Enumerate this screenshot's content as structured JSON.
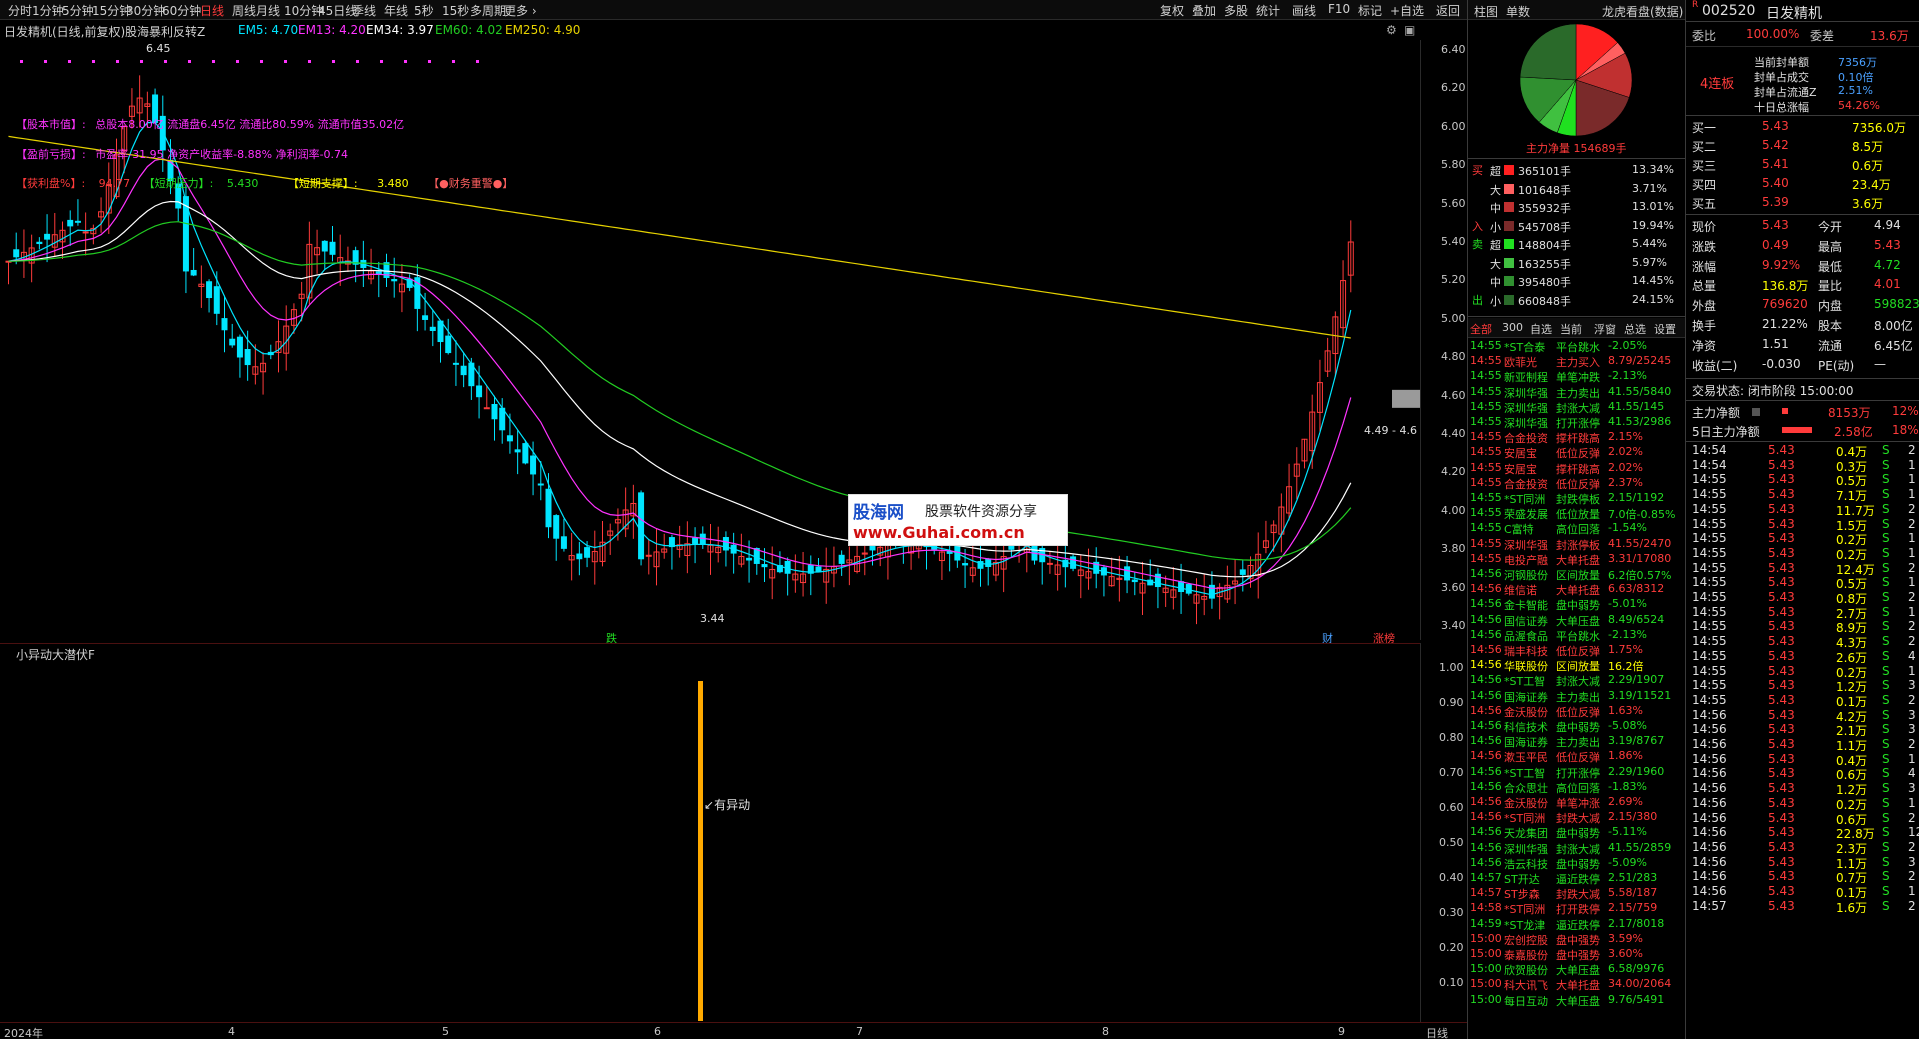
{
  "toolbar": {
    "left": [
      "分时",
      "1分钟",
      "5分钟",
      "15分钟",
      "30分钟",
      "60分钟",
      "日线",
      "周线",
      "月线",
      "10分钟",
      "45日线",
      "季线",
      "年线",
      "5秒",
      "15秒",
      "多周期",
      "更多 ›"
    ],
    "active": "日线",
    "right": [
      "复权",
      "叠加",
      "多股",
      "统计",
      "画线",
      "F10",
      "标记",
      "+自选",
      "返回"
    ]
  },
  "chart_info": {
    "title": "日发精机(日线,前复权)",
    "indicator": "股海暴利反转Z",
    "em5": "EM5: 4.70",
    "em13": "EM13: 4.20",
    "em34": "EM34: 3.97",
    "em60": "EM60: 4.02",
    "em250": "EM250: 4.90"
  },
  "fundamentals": {
    "line1_label": "【股本市值】:",
    "line1_value": "总股本8.00亿  流通盘6.45亿  流通比80.59%  流通市值35.02亿",
    "line2_label": "【盈前亏损】:",
    "line2_value": "市盈率-31.95  净资产收益率-8.88%  净利润率-0.74",
    "line3_label": "【获利盘%】:",
    "line3_value": "94.77",
    "pressure_label": "【短期压力】:",
    "pressure_value": "5.430",
    "support_label": "【短期支撑】:",
    "support_value": "3.480",
    "risk": "【●财务重警●】"
  },
  "price_axis": [
    "6.40",
    "6.20",
    "6.00",
    "5.80",
    "5.60",
    "5.40",
    "5.20",
    "5.00",
    "4.80",
    "4.60",
    "4.40",
    "4.20",
    "4.00",
    "3.80",
    "3.60",
    "3.40"
  ],
  "chart_labels": {
    "high": "6.45",
    "low": "3.44",
    "range": "4.49 - 4.6",
    "tag_down": "跌",
    "tag_fin": "财",
    "tag_limit": "涨榜"
  },
  "sub_chart": {
    "title": "小异动大潜伏F",
    "signal": "有异动",
    "axis": [
      "1.00",
      "0.90",
      "0.80",
      "0.70",
      "0.60",
      "0.50",
      "0.40",
      "0.30",
      "0.20",
      "0.10"
    ]
  },
  "date_axis": {
    "labels": [
      "2024年",
      "4",
      "5",
      "6",
      "7",
      "8",
      "9"
    ],
    "period": "日线"
  },
  "mid_panel": {
    "tabs": [
      "柱图",
      "单数"
    ],
    "dragon": "龙虎看盘(数据)",
    "net_inflow": "主力净量 154689手",
    "buy_label": "买",
    "sell_label": "卖",
    "in_label": "入",
    "out_label": "出",
    "flows": [
      {
        "size": "超",
        "vol": "365101手",
        "pct": "13.34%",
        "color": "#ff2020"
      },
      {
        "size": "大",
        "vol": "101648手",
        "pct": "3.71%",
        "color": "#ff6060"
      },
      {
        "size": "中",
        "vol": "355932手",
        "pct": "13.01%",
        "color": "#c03030"
      },
      {
        "size": "小",
        "vol": "545708手",
        "pct": "19.94%",
        "color": "#7a2a2a"
      },
      {
        "size": "超",
        "vol": "148804手",
        "pct": "5.44%",
        "color": "#20e020"
      },
      {
        "size": "大",
        "vol": "163255手",
        "pct": "5.97%",
        "color": "#40c040"
      },
      {
        "size": "中",
        "vol": "395480手",
        "pct": "14.45%",
        "color": "#309030"
      },
      {
        "size": "小",
        "vol": "660848手",
        "pct": "24.15%",
        "color": "#2a6a2a"
      }
    ],
    "list_tabs": [
      "全部",
      "300",
      "自选",
      "当前",
      "浮窗",
      "总选",
      "设置"
    ],
    "alerts": [
      {
        "t": "14:55",
        "n": "*ST合泰",
        "e": "平台跳水",
        "v": "-2.05%",
        "c": "green"
      },
      {
        "t": "14:55",
        "n": "欧菲光",
        "e": "主力买入",
        "v": "8.79/25245",
        "c": "red"
      },
      {
        "t": "14:55",
        "n": "新亚制程",
        "e": "单笔冲跌",
        "v": "-2.13%",
        "c": "green"
      },
      {
        "t": "14:55",
        "n": "深圳华强",
        "e": "主力卖出",
        "v": "41.55/5840",
        "c": "green"
      },
      {
        "t": "14:55",
        "n": "深圳华强",
        "e": "封涨大减",
        "v": "41.55/145",
        "c": "green"
      },
      {
        "t": "14:55",
        "n": "深圳华强",
        "e": "打开涨停",
        "v": "41.53/2986",
        "c": "green"
      },
      {
        "t": "14:55",
        "n": "合金投资",
        "e": "撑杆跳高",
        "v": "2.15%",
        "c": "red"
      },
      {
        "t": "14:55",
        "n": "安居宝",
        "e": "低位反弹",
        "v": "2.02%",
        "c": "red"
      },
      {
        "t": "14:55",
        "n": "安居宝",
        "e": "撑杆跳高",
        "v": "2.02%",
        "c": "red"
      },
      {
        "t": "14:55",
        "n": "合金投资",
        "e": "低位反弹",
        "v": "2.37%",
        "c": "red"
      },
      {
        "t": "14:55",
        "n": "*ST同洲",
        "e": "封跌停板",
        "v": "2.15/1192",
        "c": "green"
      },
      {
        "t": "14:55",
        "n": "荣盛发展",
        "e": "低位放量",
        "v": "7.0倍-0.85%",
        "c": "green"
      },
      {
        "t": "14:55",
        "n": "C富特",
        "e": "高位回落",
        "v": "-1.54%",
        "c": "green"
      },
      {
        "t": "14:55",
        "n": "深圳华强",
        "e": "封涨停板",
        "v": "41.55/2470",
        "c": "red"
      },
      {
        "t": "14:55",
        "n": "电投产融",
        "e": "大单托盘",
        "v": "3.31/17080",
        "c": "red"
      },
      {
        "t": "14:56",
        "n": "河钢股份",
        "e": "区间放量",
        "v": "6.2倍0.57%",
        "c": "green"
      },
      {
        "t": "14:56",
        "n": "维信诺",
        "e": "大单托盘",
        "v": "6.63/8312",
        "c": "red"
      },
      {
        "t": "14:56",
        "n": "金卡智能",
        "e": "盘中弱势",
        "v": "-5.01%",
        "c": "green"
      },
      {
        "t": "14:56",
        "n": "国信证券",
        "e": "大单压盘",
        "v": "8.49/6524",
        "c": "green"
      },
      {
        "t": "14:56",
        "n": "品渥食品",
        "e": "平台跳水",
        "v": "-2.13%",
        "c": "green"
      },
      {
        "t": "14:56",
        "n": "瑞丰科技",
        "e": "低位反弹",
        "v": "1.75%",
        "c": "red"
      },
      {
        "t": "14:56",
        "n": "华联股份",
        "e": "区间放量",
        "v": "16.2倍",
        "c": "yellow"
      },
      {
        "t": "14:56",
        "n": "*ST工智",
        "e": "封涨大减",
        "v": "2.29/1907",
        "c": "green"
      },
      {
        "t": "14:56",
        "n": "国海证券",
        "e": "主力卖出",
        "v": "3.19/11521",
        "c": "green"
      },
      {
        "t": "14:56",
        "n": "金沃股份",
        "e": "低位反弹",
        "v": "1.63%",
        "c": "red"
      },
      {
        "t": "14:56",
        "n": "科信技术",
        "e": "盘中弱势",
        "v": "-5.08%",
        "c": "green"
      },
      {
        "t": "14:56",
        "n": "国海证券",
        "e": "主力卖出",
        "v": "3.19/8767",
        "c": "green"
      },
      {
        "t": "14:56",
        "n": "漱玉平民",
        "e": "低位反弹",
        "v": "1.86%",
        "c": "red"
      },
      {
        "t": "14:56",
        "n": "*ST工智",
        "e": "打开涨停",
        "v": "2.29/1960",
        "c": "green"
      },
      {
        "t": "14:56",
        "n": "合众思壮",
        "e": "高位回落",
        "v": "-1.83%",
        "c": "green"
      },
      {
        "t": "14:56",
        "n": "金沃股份",
        "e": "单笔冲涨",
        "v": "2.69%",
        "c": "red"
      },
      {
        "t": "14:56",
        "n": "*ST同洲",
        "e": "封跌大减",
        "v": "2.15/380",
        "c": "red"
      },
      {
        "t": "14:56",
        "n": "天龙集团",
        "e": "盘中弱势",
        "v": "-5.11%",
        "c": "green"
      },
      {
        "t": "14:56",
        "n": "深圳华强",
        "e": "封涨大减",
        "v": "41.55/2859",
        "c": "green"
      },
      {
        "t": "14:56",
        "n": "浩云科技",
        "e": "盘中弱势",
        "v": "-5.09%",
        "c": "green"
      },
      {
        "t": "14:57",
        "n": "ST开达",
        "e": "逼近跌停",
        "v": "2.51/283",
        "c": "green"
      },
      {
        "t": "14:57",
        "n": "ST步森",
        "e": "封跌大减",
        "v": "5.58/187",
        "c": "red"
      },
      {
        "t": "14:58",
        "n": "*ST同洲",
        "e": "打开跌停",
        "v": "2.15/759",
        "c": "red"
      },
      {
        "t": "14:59",
        "n": "*ST龙津",
        "e": "逼近跌停",
        "v": "2.17/8018",
        "c": "green"
      },
      {
        "t": "15:00",
        "n": "宏创控股",
        "e": "盘中强势",
        "v": "3.59%",
        "c": "red"
      },
      {
        "t": "15:00",
        "n": "泰嘉股份",
        "e": "盘中强势",
        "v": "3.60%",
        "c": "red"
      },
      {
        "t": "15:00",
        "n": "欣贺股份",
        "e": "大单压盘",
        "v": "6.58/9976",
        "c": "green"
      },
      {
        "t": "15:00",
        "n": "科大讯飞",
        "e": "大单托盘",
        "v": "34.00/2064",
        "c": "red"
      },
      {
        "t": "15:00",
        "n": "每日互动",
        "e": "大单压盘",
        "v": "9.76/5491",
        "c": "green"
      }
    ]
  },
  "far_panel": {
    "code": "002520",
    "name": "日发精机",
    "r_mark": "R",
    "wb_label": "委比",
    "wb_value": "100.00%",
    "wc_label": "委差",
    "wc_value": "13.6万",
    "streak": "4连板",
    "seal": [
      {
        "l": "当前封单额",
        "v": "7356万"
      },
      {
        "l": "封单占成交",
        "v": "0.10倍"
      },
      {
        "l": "封单占流通Z",
        "v": "2.51%"
      },
      {
        "l": "十日总涨幅",
        "v": "54.26%"
      }
    ],
    "bids": [
      {
        "l": "买一",
        "p": "5.43",
        "v": "7356.0万"
      },
      {
        "l": "买二",
        "p": "5.42",
        "v": "8.5万"
      },
      {
        "l": "买三",
        "p": "5.41",
        "v": "0.6万"
      },
      {
        "l": "买四",
        "p": "5.40",
        "v": "23.4万"
      },
      {
        "l": "买五",
        "p": "5.39",
        "v": "3.6万"
      }
    ],
    "quote": [
      {
        "l1": "现价",
        "v1": "5.43",
        "c1": "red",
        "l2": "今开",
        "v2": "4.94",
        "c2": "white"
      },
      {
        "l1": "涨跌",
        "v1": "0.49",
        "c1": "red",
        "l2": "最高",
        "v2": "5.43",
        "c2": "red"
      },
      {
        "l1": "涨幅",
        "v1": "9.92%",
        "c1": "red",
        "l2": "最低",
        "v2": "4.72",
        "c2": "green"
      },
      {
        "l1": "总量",
        "v1": "136.8万",
        "c1": "yellow",
        "l2": "量比",
        "v2": "4.01",
        "c2": "red"
      },
      {
        "l1": "外盘",
        "v1": "769620",
        "c1": "red",
        "l2": "内盘",
        "v2": "598823",
        "c2": "green"
      },
      {
        "l1": "换手",
        "v1": "21.22%",
        "c1": "white",
        "l2": "股本",
        "v2": "8.00亿",
        "c2": "white"
      },
      {
        "l1": "净资",
        "v1": "1.51",
        "c1": "white",
        "l2": "流通",
        "v2": "6.45亿",
        "c2": "white"
      },
      {
        "l1": "收益(二)",
        "v1": "-0.030",
        "c1": "white",
        "l2": "PE(动)",
        "v2": "—",
        "c2": "white"
      }
    ],
    "status": "交易状态: 闭市阶段 15:00:00",
    "net_label": "主力净额",
    "net_value": "8153万",
    "net_pct": "12%",
    "net5_label": "5日主力净额",
    "net5_value": "2.58亿",
    "net5_pct": "18%",
    "ticks": [
      {
        "t": "14:54",
        "p": "5.43",
        "v": "0.4万",
        "s": "S",
        "n": "2"
      },
      {
        "t": "14:54",
        "p": "5.43",
        "v": "0.3万",
        "s": "S",
        "n": "1"
      },
      {
        "t": "14:55",
        "p": "5.43",
        "v": "0.5万",
        "s": "S",
        "n": "1"
      },
      {
        "t": "14:55",
        "p": "5.43",
        "v": "7.1万",
        "s": "S",
        "n": "1"
      },
      {
        "t": "14:55",
        "p": "5.43",
        "v": "11.7万",
        "s": "S",
        "n": "2"
      },
      {
        "t": "14:55",
        "p": "5.43",
        "v": "1.5万",
        "s": "S",
        "n": "2"
      },
      {
        "t": "14:55",
        "p": "5.43",
        "v": "0.2万",
        "s": "S",
        "n": "1"
      },
      {
        "t": "14:55",
        "p": "5.43",
        "v": "0.2万",
        "s": "S",
        "n": "1"
      },
      {
        "t": "14:55",
        "p": "5.43",
        "v": "12.4万",
        "s": "S",
        "n": "2"
      },
      {
        "t": "14:55",
        "p": "5.43",
        "v": "0.5万",
        "s": "S",
        "n": "1"
      },
      {
        "t": "14:55",
        "p": "5.43",
        "v": "0.8万",
        "s": "S",
        "n": "2"
      },
      {
        "t": "14:55",
        "p": "5.43",
        "v": "2.7万",
        "s": "S",
        "n": "1"
      },
      {
        "t": "14:55",
        "p": "5.43",
        "v": "8.9万",
        "s": "S",
        "n": "2"
      },
      {
        "t": "14:55",
        "p": "5.43",
        "v": "4.3万",
        "s": "S",
        "n": "2"
      },
      {
        "t": "14:55",
        "p": "5.43",
        "v": "2.6万",
        "s": "S",
        "n": "4"
      },
      {
        "t": "14:55",
        "p": "5.43",
        "v": "0.2万",
        "s": "S",
        "n": "1"
      },
      {
        "t": "14:55",
        "p": "5.43",
        "v": "1.2万",
        "s": "S",
        "n": "3"
      },
      {
        "t": "14:55",
        "p": "5.43",
        "v": "0.1万",
        "s": "S",
        "n": "2"
      },
      {
        "t": "14:56",
        "p": "5.43",
        "v": "4.2万",
        "s": "S",
        "n": "3"
      },
      {
        "t": "14:56",
        "p": "5.43",
        "v": "2.1万",
        "s": "S",
        "n": "3"
      },
      {
        "t": "14:56",
        "p": "5.43",
        "v": "1.1万",
        "s": "S",
        "n": "2"
      },
      {
        "t": "14:56",
        "p": "5.43",
        "v": "0.4万",
        "s": "S",
        "n": "1"
      },
      {
        "t": "14:56",
        "p": "5.43",
        "v": "0.6万",
        "s": "S",
        "n": "4"
      },
      {
        "t": "14:56",
        "p": "5.43",
        "v": "1.2万",
        "s": "S",
        "n": "3"
      },
      {
        "t": "14:56",
        "p": "5.43",
        "v": "0.2万",
        "s": "S",
        "n": "1"
      },
      {
        "t": "14:56",
        "p": "5.43",
        "v": "0.6万",
        "s": "S",
        "n": "2"
      },
      {
        "t": "14:56",
        "p": "5.43",
        "v": "22.8万",
        "s": "S",
        "n": "12"
      },
      {
        "t": "14:56",
        "p": "5.43",
        "v": "2.3万",
        "s": "S",
        "n": "2"
      },
      {
        "t": "14:56",
        "p": "5.43",
        "v": "1.1万",
        "s": "S",
        "n": "3"
      },
      {
        "t": "14:56",
        "p": "5.43",
        "v": "0.7万",
        "s": "S",
        "n": "2"
      },
      {
        "t": "14:56",
        "p": "5.43",
        "v": "0.1万",
        "s": "S",
        "n": "1"
      },
      {
        "t": "14:57",
        "p": "5.43",
        "v": "1.6万",
        "s": "S",
        "n": "2"
      }
    ]
  },
  "watermark": {
    "site": "股海网",
    "slogan": "股票软件资源分享",
    "url": "www.Guhai.com.cn"
  },
  "colors": {
    "em5": "#00e5ff",
    "em13": "#ff33ff",
    "em34": "#ffffff",
    "em60": "#22cc22",
    "em250": "#e6d200",
    "up": "#ff3b3b",
    "down": "#00e5ff",
    "signal": "#ffaa00"
  }
}
